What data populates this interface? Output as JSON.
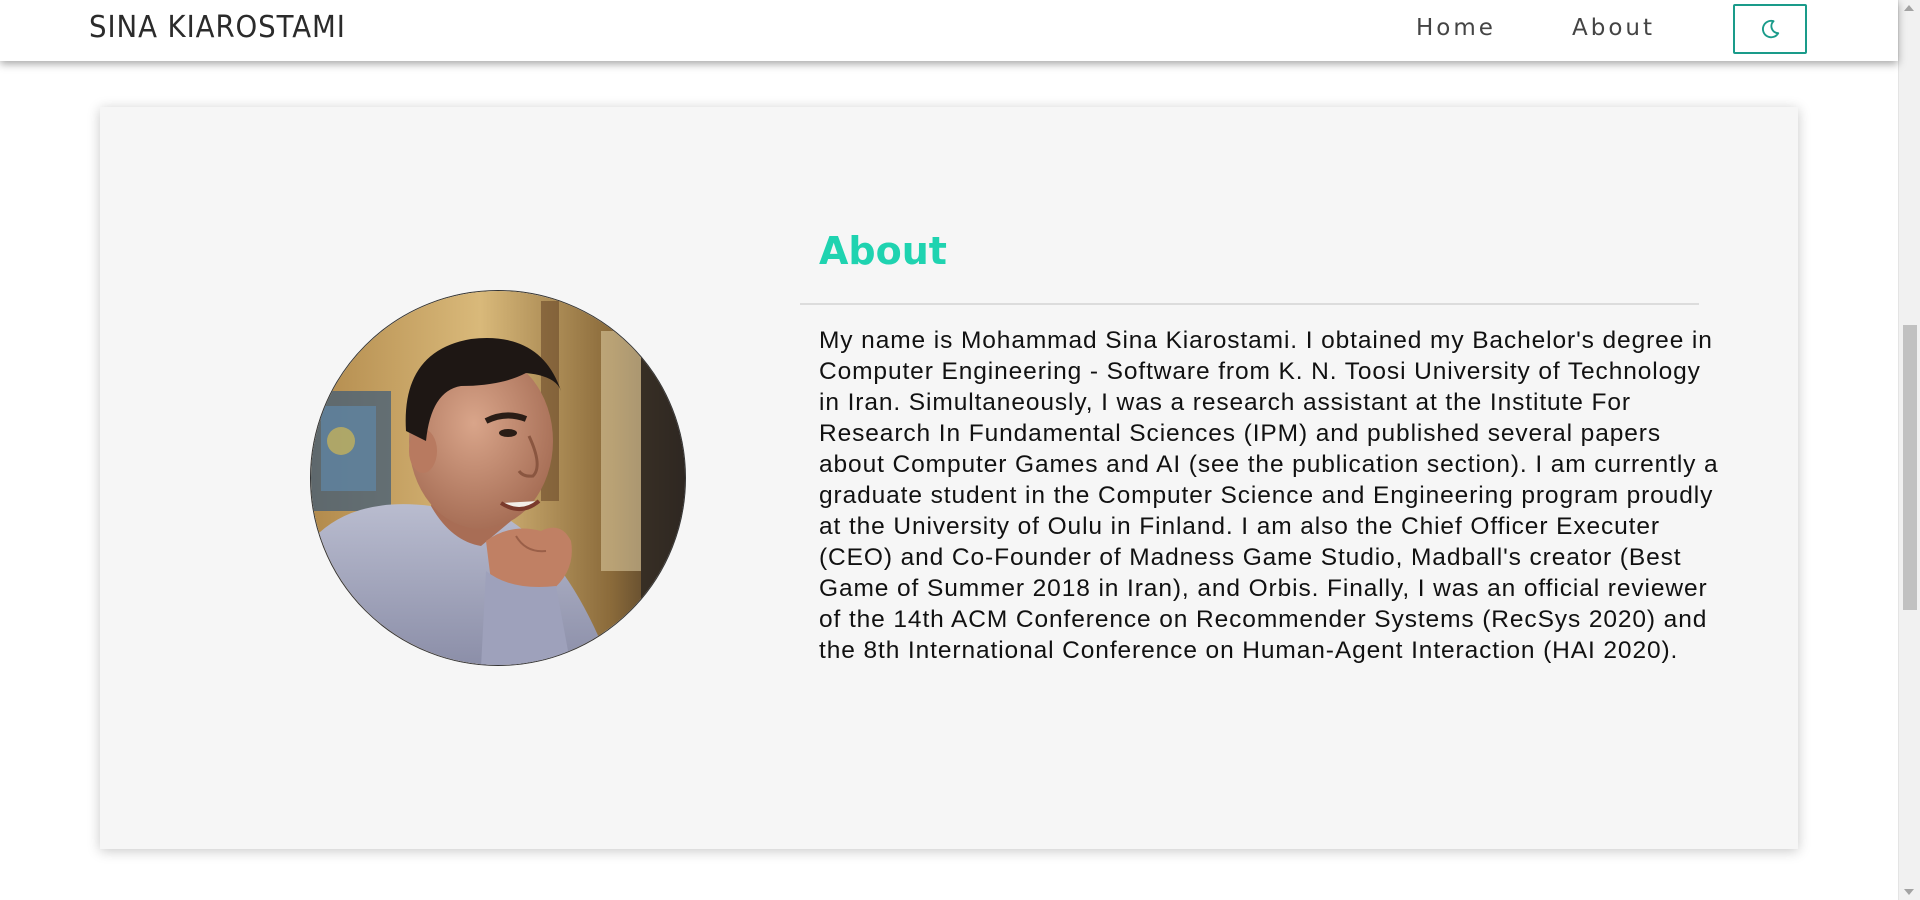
{
  "navbar": {
    "brand": "SINA KIAROSTAMI",
    "links": [
      {
        "label": "Home"
      },
      {
        "label": "About"
      }
    ],
    "theme_toggle_icon": "moon-icon"
  },
  "about": {
    "heading": "About",
    "avatar_alt": "profile-photo",
    "body": "My name is Mohammad Sina Kiarostami. I obtained my Bachelor's degree in Computer Engineering - Software from K. N. Toosi University of Technology in Iran. Simultaneously, I was a research assistant at the Institute For Research In Fundamental Sciences (IPM) and published several papers about Computer Games and AI (see the publication section). I am currently a graduate student in the Computer Science and Engineering program proudly at the University of Oulu in Finland. I am also the Chief Officer Executer (CEO) and Co-Founder of Madness Game Studio, Madball's creator (Best Game of Summer 2018 in Iran), and Orbis. Finally, I was an official reviewer of the 14th ACM Conference on Recommender Systems (RecSys 2020) and the 8th International Conference on Human-Agent Interaction (HAI 2020)."
  },
  "colors": {
    "accent": "#1fd3b0",
    "toggle_border": "#1a9b8a",
    "card_bg": "#f6f6f6"
  }
}
